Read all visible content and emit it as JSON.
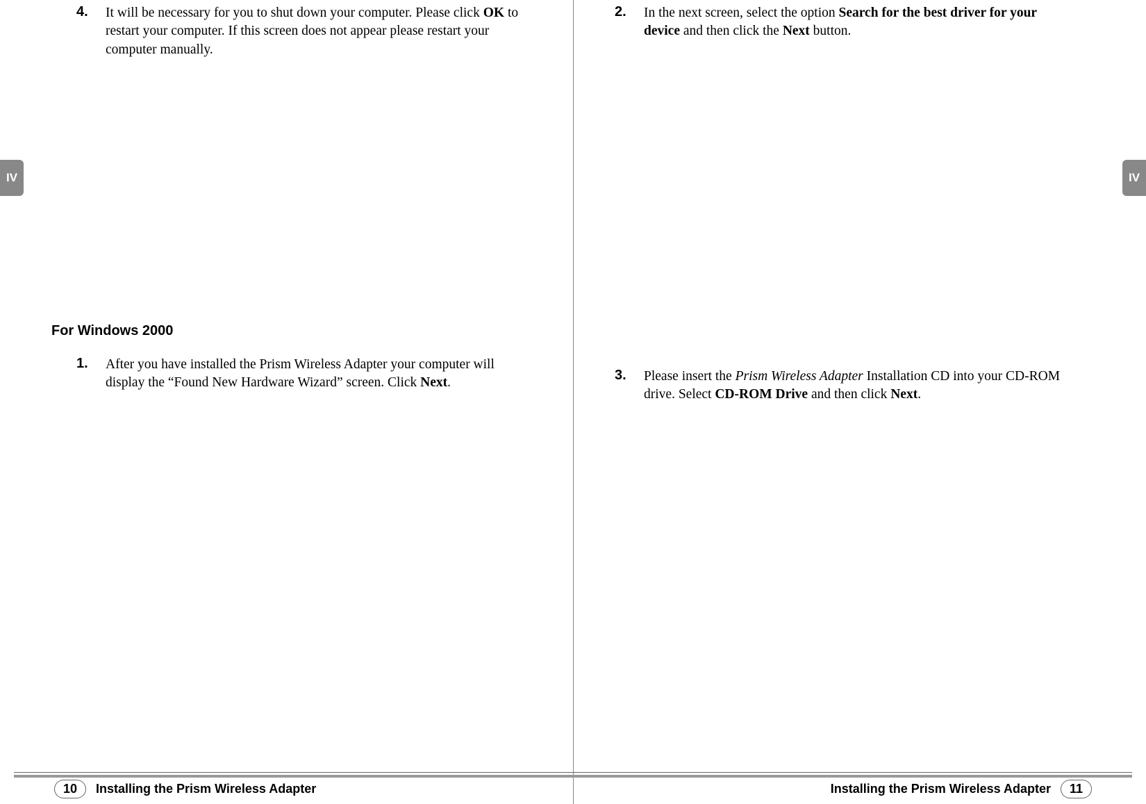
{
  "section_tab": "IV",
  "left_page": {
    "steps_top": [
      {
        "num": "4.",
        "html": "It will be necessary for you to shut down your computer. Please click <b>OK</b> to restart your computer. If this screen does not appear please restart your computer manually."
      }
    ],
    "subheading": "For Windows 2000",
    "steps_bottom": [
      {
        "num": "1.",
        "html": "After you have installed the Prism Wireless Adapter your computer will display the “Found New Hardware Wizard” screen. Click <b>Next</b>."
      }
    ],
    "footer": {
      "page_num": "10",
      "title": "Installing the Prism Wireless Adapter"
    }
  },
  "right_page": {
    "steps_top": [
      {
        "num": "2.",
        "html": "In the next screen, select the option <b>Search for the best driver for your device</b> and then click the <b>Next</b> button."
      }
    ],
    "steps_mid": [
      {
        "num": "3.",
        "html": "Please insert the <i>Prism Wireless Adapter</i> Installation CD into your CD-ROM drive. Select <b>CD-ROM Drive</b> and then click <b>Next</b>."
      }
    ],
    "footer": {
      "page_num": "11",
      "title": "Installing the Prism Wireless Adapter"
    }
  }
}
